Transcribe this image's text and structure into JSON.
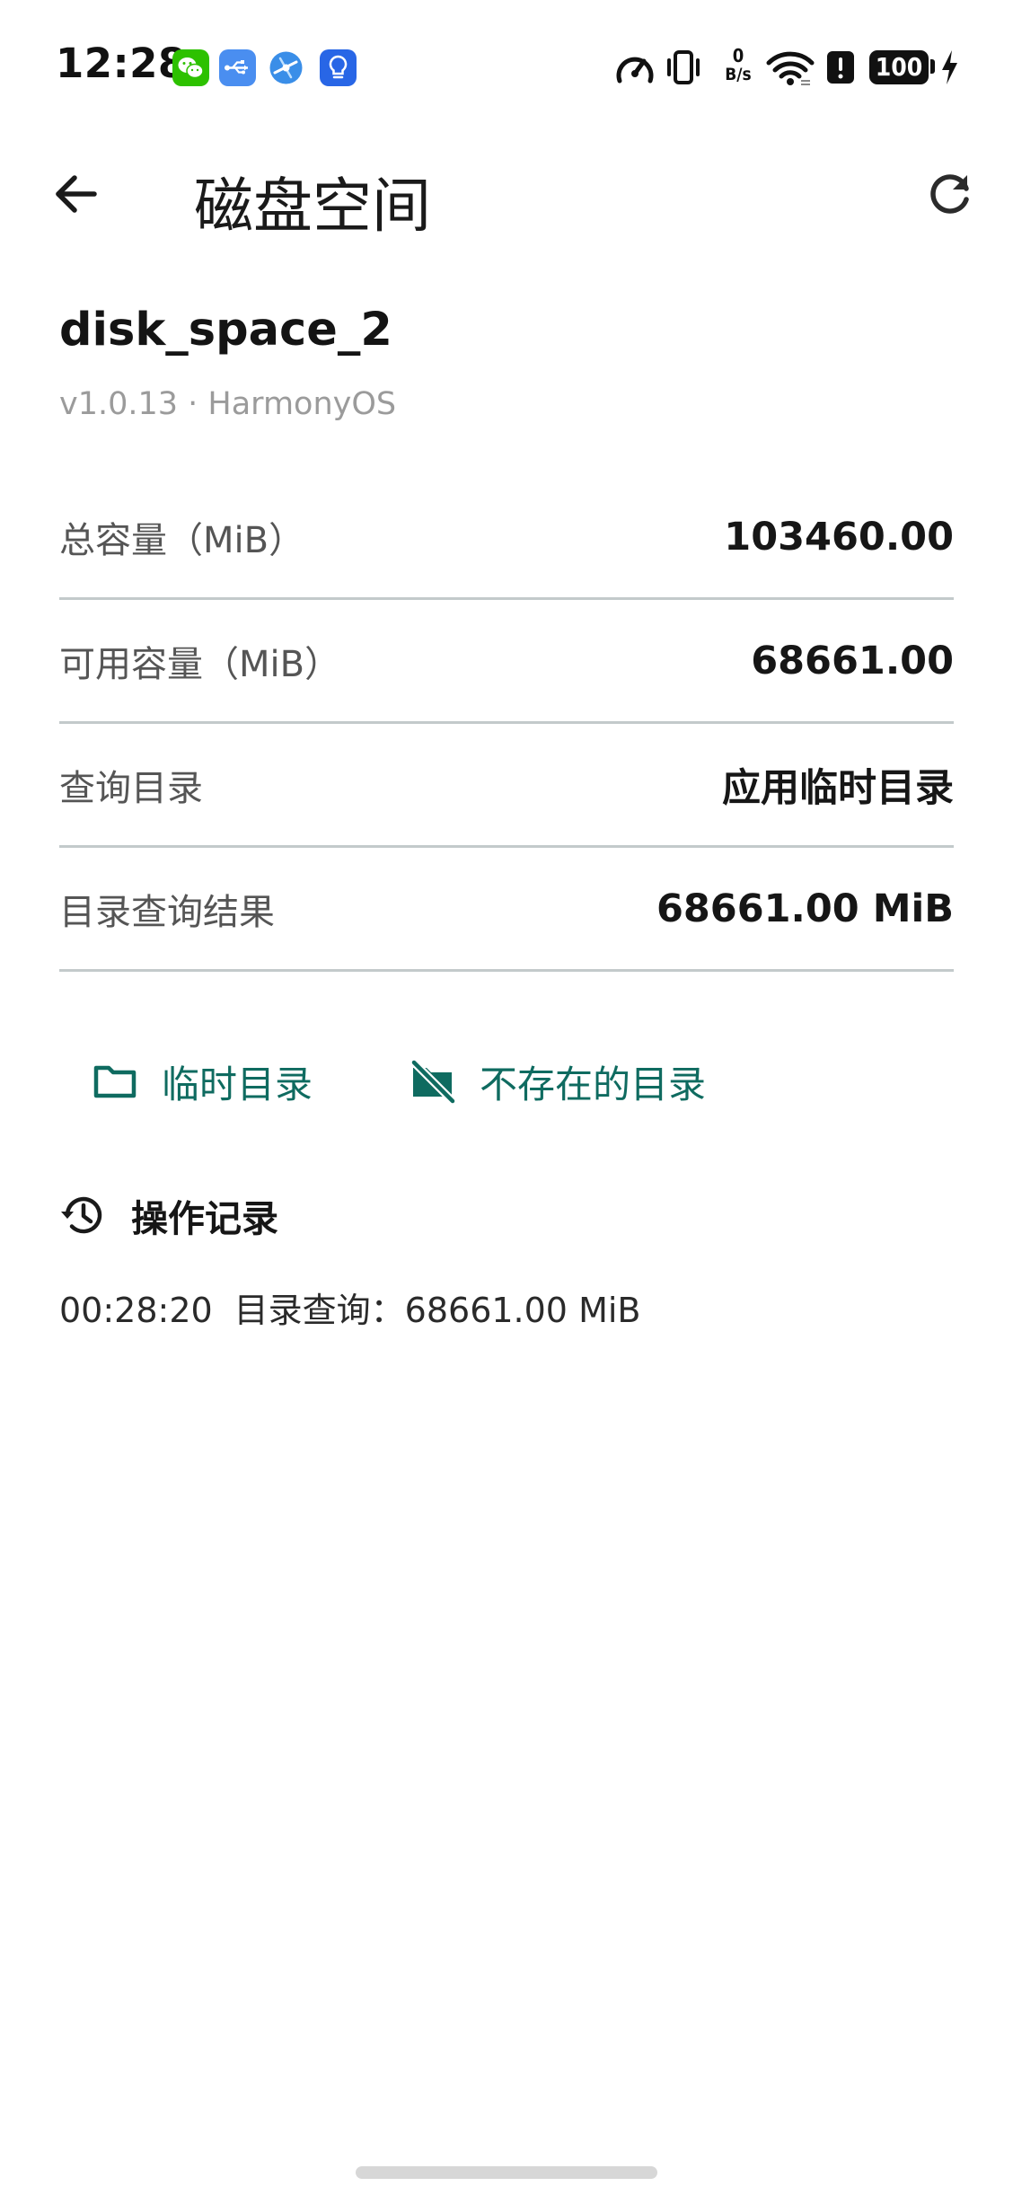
{
  "status_bar": {
    "time": "12:28",
    "network_speed_value": "0",
    "network_speed_unit": "B/s",
    "battery_level": "100",
    "notification_icons": [
      "wechat-icon",
      "usb-icon",
      "browser-icon",
      "lightbulb-icon"
    ],
    "system_icons": [
      "speedometer-icon",
      "vibrate-icon",
      "network-speed-icon",
      "wifi-icon",
      "alert-icon",
      "battery-icon",
      "charging-icon"
    ]
  },
  "app_bar": {
    "title": "磁盘空间",
    "back_icon": "arrow-left-icon",
    "refresh_icon": "refresh-icon"
  },
  "app_info": {
    "name": "disk_space_2",
    "meta": "v1.0.13 · HarmonyOS"
  },
  "info_rows": [
    {
      "label": "总容量（MiB）",
      "value": "103460.00"
    },
    {
      "label": "可用容量（MiB）",
      "value": "68661.00"
    },
    {
      "label": "查询目录",
      "value": "应用临时目录"
    },
    {
      "label": "目录查询结果",
      "value": "68661.00 MiB"
    }
  ],
  "actions": {
    "temp_dir_label": "临时目录",
    "temp_dir_icon": "folder-icon",
    "missing_dir_label": "不存在的目录",
    "missing_dir_icon": "folder-off-icon"
  },
  "log": {
    "title": "操作记录",
    "icon": "history-icon",
    "entries": [
      {
        "time": "00:28:20",
        "message": "目录查询：68661.00 MiB"
      }
    ]
  },
  "colors": {
    "accent": "#0f6b60",
    "divider": "#c3cacb",
    "muted_text": "#9b9b9b",
    "label_text": "#555555",
    "background": "#ffffff"
  }
}
